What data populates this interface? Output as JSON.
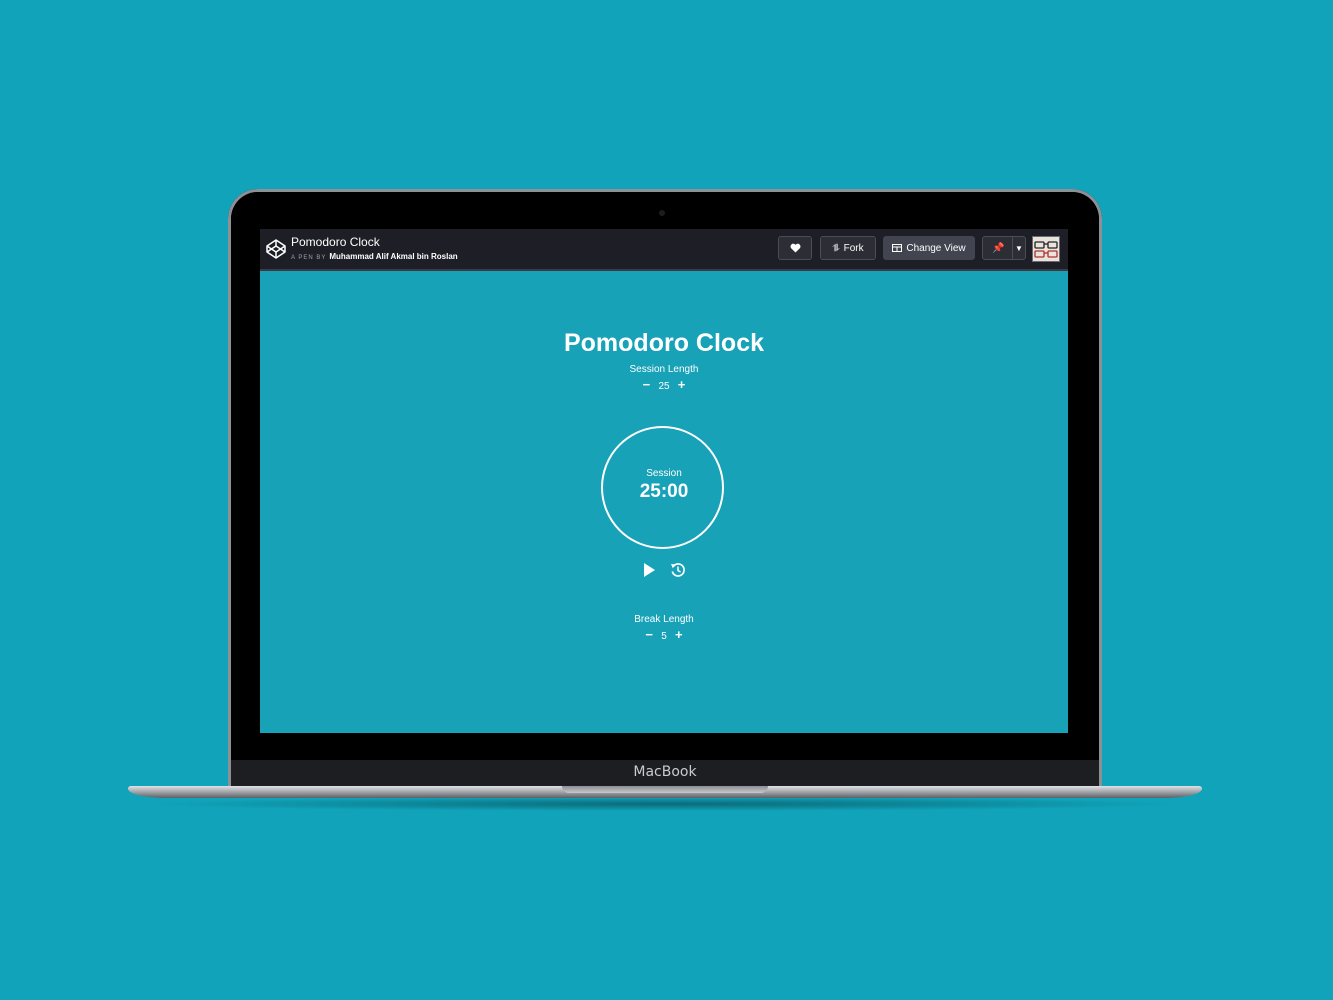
{
  "device": {
    "brand": "MacBook"
  },
  "codepen": {
    "logo_icon": "codepen-logo-icon",
    "pen_title": "Pomodoro Clock",
    "pen_by_label": "A PEN BY",
    "author": "Muhammad Alif Akmal bin Roslan",
    "buttons": {
      "heart_icon": "heart-icon",
      "fork_label": "Fork",
      "fork_icon": "fork-icon",
      "change_view_label": "Change View",
      "change_view_icon": "layout-icon",
      "pin_icon": "pin-icon",
      "dropdown_icon": "chevron-down-icon"
    }
  },
  "app": {
    "title": "Pomodoro Clock",
    "session_length": {
      "label": "Session Length",
      "value": "25",
      "decrement": "−",
      "increment": "+"
    },
    "timer": {
      "label": "Session",
      "value": "25:00"
    },
    "controls": {
      "play_icon": "play-icon",
      "reset_icon": "reset-icon"
    },
    "break_length": {
      "label": "Break Length",
      "value": "5",
      "decrement": "−",
      "increment": "+"
    }
  },
  "colors": {
    "background": "#10a3b9",
    "app_background": "#17a2b8",
    "topbar": "#1e1f26",
    "text": "#ffffff"
  }
}
